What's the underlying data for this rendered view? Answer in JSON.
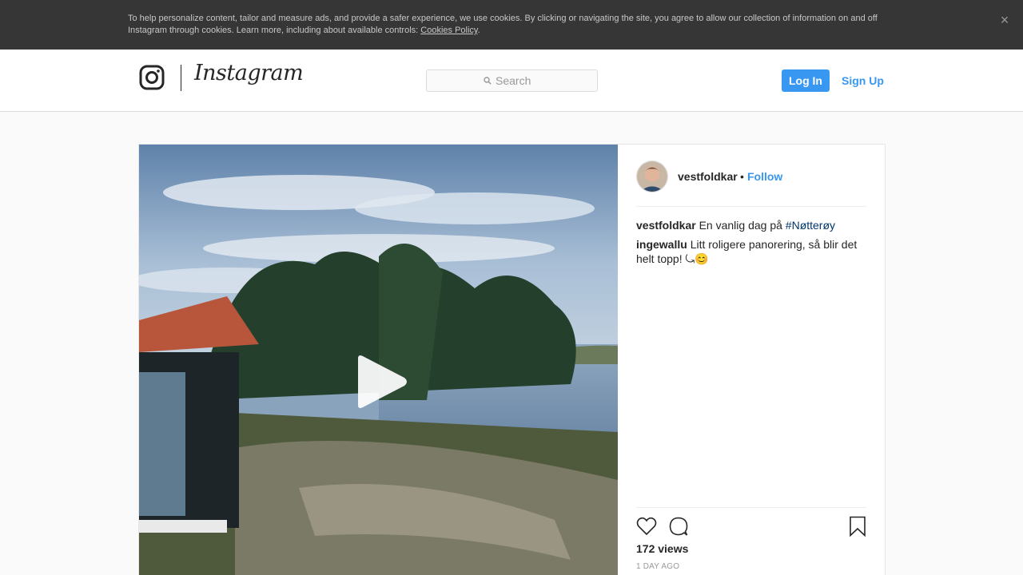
{
  "cookie_banner": {
    "text": "To help personalize content, tailor and measure ads, and provide a safer experience, we use cookies. By clicking or navigating the site, you agree to allow our collection of information on and off Instagram through cookies. Learn more, including about available controls: ",
    "link": "Cookies Policy",
    "after_link": ".",
    "close_glyph": "×"
  },
  "nav": {
    "brand": "Instagram",
    "search_placeholder": "Search",
    "login_label": "Log In",
    "signup_label": "Sign Up"
  },
  "post": {
    "username": "vestfoldkar",
    "separator": "•",
    "follow_label": "Follow",
    "comments": [
      {
        "user": "vestfoldkar",
        "text": "En vanlig dag på ",
        "tag": "#Nøtterøy"
      },
      {
        "user": "ingewallu",
        "text": "Litt roligere panorering, så blir det helt topp! ⤿😊"
      }
    ],
    "views": "172 views",
    "time": "1 DAY AGO"
  },
  "colors": {
    "accent": "#3897f0",
    "hashtag": "#003569",
    "banner_bg": "#363636"
  },
  "icons": [
    "instagram-glyph-icon",
    "search-icon",
    "close-icon",
    "play-icon",
    "heart-icon",
    "comment-icon",
    "bookmark-icon"
  ]
}
